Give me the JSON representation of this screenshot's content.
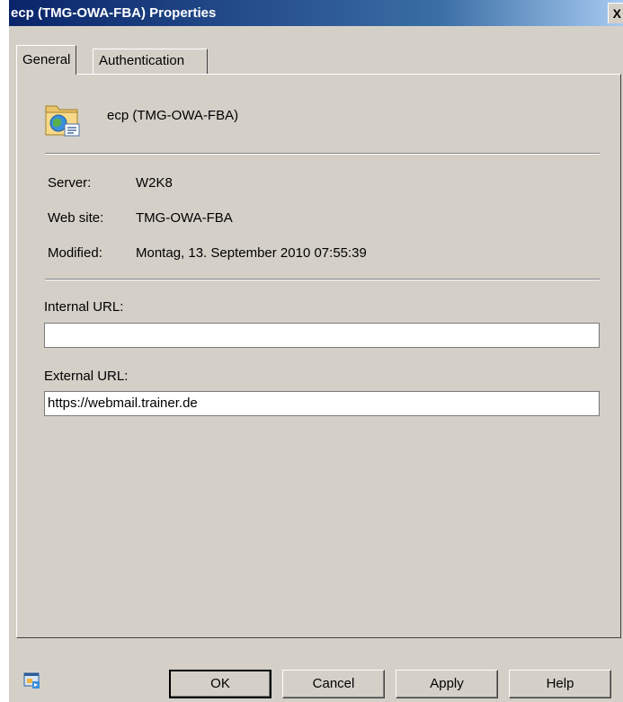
{
  "window": {
    "title": "ecp (TMG-OWA-FBA) Properties",
    "close_glyph": "X"
  },
  "tabs": [
    {
      "label": "General",
      "selected": true
    },
    {
      "label": "Authentication",
      "selected": false
    }
  ],
  "general": {
    "app_name": "ecp (TMG-OWA-FBA)",
    "app_icon": "web-folder-icon",
    "server_label": "Server:",
    "server_value": "W2K8",
    "website_label": "Web site:",
    "website_value": "TMG-OWA-FBA",
    "modified_label": "Modified:",
    "modified_value": "Montag, 13. September 2010 07:55:39",
    "internal_url_label": "Internal URL:",
    "internal_url_value": "",
    "external_url_label": "External URL:",
    "external_url_value": "https://webmail.trainer.de"
  },
  "buttons": {
    "ok": "OK",
    "cancel": "Cancel",
    "apply": "Apply",
    "help": "Help"
  },
  "footer_icon": "console-icon"
}
